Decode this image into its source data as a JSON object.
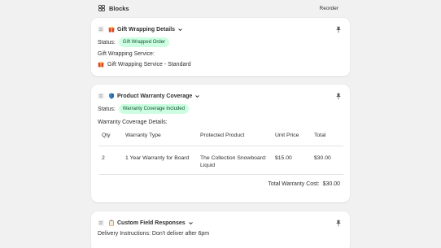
{
  "header": {
    "title": "Blocks",
    "reorder_label": "Reorder"
  },
  "gift": {
    "title": "Gift Wrapping Details",
    "status_label": "Status:",
    "status_badge": "Gift Wrapped Order",
    "service_label": "Gift Wrapping Service:",
    "service_value": "Gift Wrapping Service - Standard"
  },
  "warranty": {
    "title": "Product Warranty Coverage",
    "status_label": "Status:",
    "status_badge": "Warranty Coverage Included",
    "details_label": "Warranty Coverage Details:",
    "columns": [
      "Qty",
      "Warranty Type",
      "Protected Product",
      "Unit Price",
      "Total"
    ],
    "rows": [
      {
        "qty": "2",
        "type": "1 Year Warranty for Board",
        "product": "The Collection Snowboard: Liquid",
        "unit_price": "$15.00",
        "total": "$30.00"
      }
    ],
    "total_label": "Total Warranty Cost:",
    "total_value": "$30.00"
  },
  "custom": {
    "title": "Custom Field Responses",
    "delivery": "Delivery Instructions: Don't deliver after 6pm"
  },
  "colors": {
    "badge_bg": "#cdfee1",
    "badge_text": "#0c5132"
  },
  "icons": [
    "blocks-icon",
    "drag-handle-icon",
    "gift-icon",
    "shield-icon",
    "clipboard-icon",
    "chevron-down-icon",
    "pin-icon"
  ]
}
